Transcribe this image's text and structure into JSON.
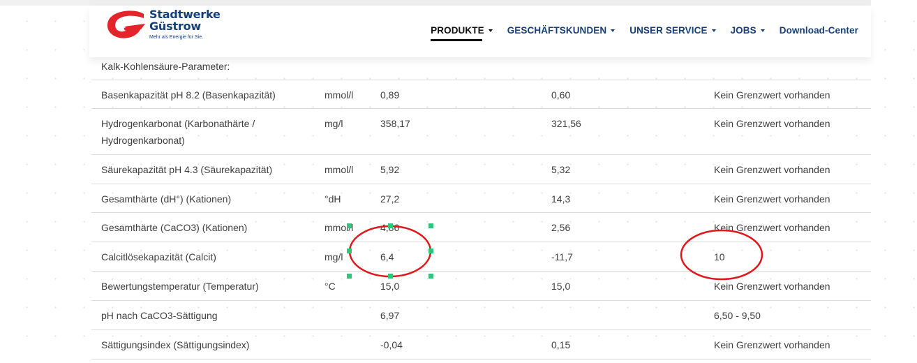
{
  "header": {
    "logo": {
      "line1": "Stadtwerke",
      "line2": "Güstrow",
      "tagline": "Mehr als Energie für Sie."
    },
    "nav": [
      {
        "label": "PRODUKTE",
        "has_caret": true,
        "active": true
      },
      {
        "label": "GESCHÄFTSKUNDEN",
        "has_caret": true,
        "active": false
      },
      {
        "label": "UNSER SERVICE",
        "has_caret": true,
        "active": false
      },
      {
        "label": "JOBS",
        "has_caret": true,
        "active": false
      },
      {
        "label": "Download-Center",
        "has_caret": false,
        "active": false
      }
    ]
  },
  "table": {
    "section_label": "Kalk-Kohlensäure-Parameter:",
    "rows": [
      {
        "name": "Basenkapazität pH 8.2 (Basenkapazität)",
        "unit": "mmol/l",
        "value1": "0,89",
        "value2": "0,60",
        "limit": "Kein Grenzwert vorhanden"
      },
      {
        "name": "Hydrogenkarbonat (Karbonathärte / Hydrogenkarbonat)",
        "unit": "mg/l",
        "value1": "358,17",
        "value2": "321,56",
        "limit": "Kein Grenzwert vorhanden"
      },
      {
        "name": "Säurekapazität pH 4.3 (Säurekapazität)",
        "unit": "mmol/l",
        "value1": "5,92",
        "value2": "5,32",
        "limit": "Kein Grenzwert vorhanden"
      },
      {
        "name": "Gesamthärte (dH°) (Kationen)",
        "unit": "°dH",
        "value1": "27,2",
        "value2": "14,3",
        "limit": "Kein Grenzwert vorhanden"
      },
      {
        "name": "Gesamthärte (CaCO3) (Kationen)",
        "unit": "mmol/l",
        "value1": "4,86",
        "value2": "2,56",
        "limit": "Kein Grenzwert vorhanden"
      },
      {
        "name": "Calcitlösekapazität (Calcit)",
        "unit": "mg/l",
        "value1": "6,4",
        "value2": "-11,7",
        "limit": "10"
      },
      {
        "name": "Bewertungstemperatur (Temperatur)",
        "unit": "°C",
        "value1": "15,0",
        "value2": "15,0",
        "limit": "Kein Grenzwert vorhanden"
      },
      {
        "name": "pH nach CaCO3-Sättigung",
        "unit": "",
        "value1": "6,97",
        "value2": "",
        "limit": "6,50 - 9,50"
      },
      {
        "name": "Sättigungsindex (Sättigungsindex)",
        "unit": "",
        "value1": "-0,04",
        "value2": "0,15",
        "limit": "Kein Grenzwert vorhanden"
      }
    ]
  },
  "colors": {
    "brand_blue": "#163f78",
    "brand_red": "#e3242b",
    "annotation_red": "#e0181b",
    "selection_handle": "#36c27a",
    "row_border": "#dcdcdc",
    "text": "#3e3e3e"
  },
  "icons": {
    "logo_mark": "stadtwerke-swoosh-icon",
    "nav_caret": "caret-down-icon"
  }
}
